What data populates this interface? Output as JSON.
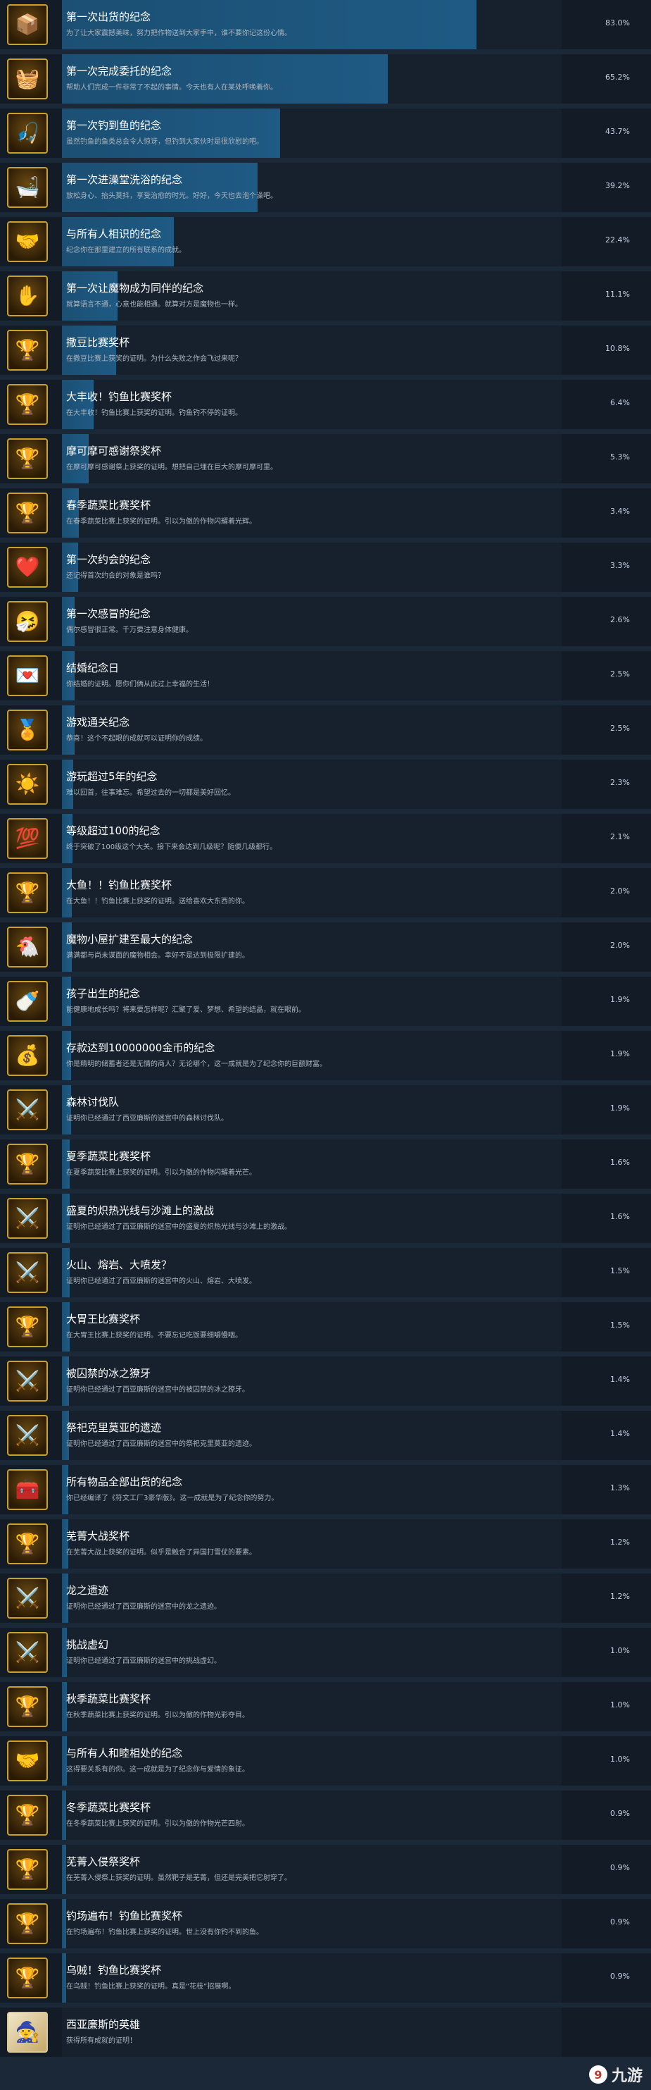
{
  "achievements": [
    {
      "icon": "📦",
      "title": "第一次出货的纪念",
      "desc": "为了让大家震撼美味，努力把作物送到大家手中，谁不要你记这份心情。",
      "pct": "83.0%",
      "value": 83.0
    },
    {
      "icon": "🧺",
      "title": "第一次完成委托的纪念",
      "desc": "帮助人们完成一件非常了不起的事情。今天也有人在某处呼唤着你。",
      "pct": "65.2%",
      "value": 65.2
    },
    {
      "icon": "🎣",
      "title": "第一次钓到鱼的纪念",
      "desc": "虽然钓鱼的鱼类总会令人惊讶，但钓到大家伙时是很欣慰的吧。",
      "pct": "43.7%",
      "value": 43.7
    },
    {
      "icon": "🛁",
      "title": "第一次进澡堂洗浴的纪念",
      "desc": "放松身心、抬头莫抖，享受治愈的时光。好好，今天也去泡个澡吧。",
      "pct": "39.2%",
      "value": 39.2
    },
    {
      "icon": "🤝",
      "title": "与所有人相识的纪念",
      "desc": "纪念你在那里建立的所有联系的成就。",
      "pct": "22.4%",
      "value": 22.4
    },
    {
      "icon": "✋",
      "title": "第一次让魔物成为同伴的纪念",
      "desc": "就算语言不通，心意也能相通。就算对方是魔物也一样。",
      "pct": "11.1%",
      "value": 11.1
    },
    {
      "icon": "🏆",
      "title": "撒豆比赛奖杯",
      "desc": "在撒豆比赛上获奖的证明。为什么失败之作会飞过来呢？",
      "pct": "10.8%",
      "value": 10.8
    },
    {
      "icon": "🏆",
      "title": "大丰收！钓鱼比赛奖杯",
      "desc": "在大丰收！钓鱼比赛上获奖的证明。钓鱼钓不停的证明。",
      "pct": "6.4%",
      "value": 6.4
    },
    {
      "icon": "🏆",
      "title": "摩可摩可感谢祭奖杯",
      "desc": "在摩可摩可感谢祭上获奖的证明。想把自己埋在巨大的摩可摩可里。",
      "pct": "5.3%",
      "value": 5.3
    },
    {
      "icon": "🏆",
      "title": "春季蔬菜比赛奖杯",
      "desc": "在春季蔬菜比赛上获奖的证明。引以为傲的作物闪耀着光辉。",
      "pct": "3.4%",
      "value": 3.4
    },
    {
      "icon": "❤️",
      "title": "第一次约会的纪念",
      "desc": "还记得首次约会的对象是谁吗？",
      "pct": "3.3%",
      "value": 3.3
    },
    {
      "icon": "🤧",
      "title": "第一次感冒的纪念",
      "desc": "偶尔感冒很正常。千万要注意身体健康。",
      "pct": "2.6%",
      "value": 2.6
    },
    {
      "icon": "💌",
      "title": "结婚纪念日",
      "desc": "你结婚的证明。愿你们俩从此过上幸福的生活！",
      "pct": "2.5%",
      "value": 2.5
    },
    {
      "icon": "🏅",
      "title": "游戏通关纪念",
      "desc": "恭喜！这个不起眼的成就可以证明你的成绩。",
      "pct": "2.5%",
      "value": 2.5
    },
    {
      "icon": "☀️",
      "title": "游玩超过5年的纪念",
      "desc": "难以回首，往事难忘。希望过去的一切都是美好回忆。",
      "pct": "2.3%",
      "value": 2.3
    },
    {
      "icon": "💯",
      "title": "等级超过100的纪念",
      "desc": "终于突破了100级这个大关。接下来会达到几级呢？随便几级都行。",
      "pct": "2.1%",
      "value": 2.1
    },
    {
      "icon": "🏆",
      "title": "大鱼！！钓鱼比赛奖杯",
      "desc": "在大鱼！！钓鱼比赛上获奖的证明。送给喜欢大东西的你。",
      "pct": "2.0%",
      "value": 2.0
    },
    {
      "icon": "🐔",
      "title": "魔物小屋扩建至最大的纪念",
      "desc": "满满都与尚未谋面的魔物相会。幸好不是达到极限扩建的。",
      "pct": "2.0%",
      "value": 2.0
    },
    {
      "icon": "🍼",
      "title": "孩子出生的纪念",
      "desc": "能健康地成长吗？将来要怎样呢？汇聚了爱、梦想、希望的结晶，就在眼前。",
      "pct": "1.9%",
      "value": 1.9
    },
    {
      "icon": "💰",
      "title": "存款达到10000000金币的纪念",
      "desc": "你是精明的储蓄者还是无情的商人？无论哪个，这一成就是为了纪念你的巨额财富。",
      "pct": "1.9%",
      "value": 1.9
    },
    {
      "icon": "⚔️",
      "title": "森林讨伐队",
      "desc": "证明你已经通过了西亚廉斯的迷宫中的森林讨伐队。",
      "pct": "1.9%",
      "value": 1.9
    },
    {
      "icon": "🏆",
      "title": "夏季蔬菜比赛奖杯",
      "desc": "在夏季蔬菜比赛上获奖的证明。引以为傲的作物闪耀着光芒。",
      "pct": "1.6%",
      "value": 1.6
    },
    {
      "icon": "⚔️",
      "title": "盛夏的炽热光线与沙滩上的激战",
      "desc": "证明你已经通过了西亚廉斯的迷宫中的盛夏的炽热光线与沙滩上的激战。",
      "pct": "1.6%",
      "value": 1.6
    },
    {
      "icon": "⚔️",
      "title": "火山、熔岩、大喷发？",
      "desc": "证明你已经通过了西亚廉斯的迷宫中的火山、熔岩、大喷发。",
      "pct": "1.5%",
      "value": 1.5
    },
    {
      "icon": "🏆",
      "title": "大胃王比赛奖杯",
      "desc": "在大胃王比赛上获奖的证明。不要忘记吃饭要细嚼慢咽。",
      "pct": "1.5%",
      "value": 1.5
    },
    {
      "icon": "⚔️",
      "title": "被囚禁的冰之獠牙",
      "desc": "证明你已经通过了西亚廉斯的迷宫中的被囚禁的冰之獠牙。",
      "pct": "1.4%",
      "value": 1.4
    },
    {
      "icon": "⚔️",
      "title": "祭祀克里莫亚的遗迹",
      "desc": "证明你已经通过了西亚廉斯的迷宫中的祭祀克里莫亚的遗迹。",
      "pct": "1.4%",
      "value": 1.4
    },
    {
      "icon": "🧰",
      "title": "所有物品全部出货的纪念",
      "desc": "你已经编译了《符文工厂3豪华版》。这一成就是为了纪念你的努力。",
      "pct": "1.3%",
      "value": 1.3
    },
    {
      "icon": "🏆",
      "title": "芜菁大战奖杯",
      "desc": "在芜菁大战上获奖的证明。似乎是触合了异国打雪仗的要素。",
      "pct": "1.2%",
      "value": 1.2
    },
    {
      "icon": "⚔️",
      "title": "龙之遗迹",
      "desc": "证明你已经通过了西亚廉斯的迷宫中的龙之遗迹。",
      "pct": "1.2%",
      "value": 1.2
    },
    {
      "icon": "⚔️",
      "title": "挑战虚幻",
      "desc": "证明你已经通过了西亚廉斯的迷宫中的挑战虚幻。",
      "pct": "1.0%",
      "value": 1.0
    },
    {
      "icon": "🏆",
      "title": "秋季蔬菜比赛奖杯",
      "desc": "在秋季蔬菜比赛上获奖的证明。引以为傲的作物光彩夺目。",
      "pct": "1.0%",
      "value": 1.0
    },
    {
      "icon": "🤝",
      "title": "与所有人和睦相处的纪念",
      "desc": "这得要关系有的你。这一成就是为了纪念你与爱情的象征。",
      "pct": "1.0%",
      "value": 1.0
    },
    {
      "icon": "🏆",
      "title": "冬季蔬菜比赛奖杯",
      "desc": "在冬季蔬菜比赛上获奖的证明。引以为傲的作物光芒四射。",
      "pct": "0.9%",
      "value": 0.9
    },
    {
      "icon": "🏆",
      "title": "芜菁入侵祭奖杯",
      "desc": "在芜菁入侵祭上获奖的证明。虽然靶子是芜菁，但还是完美把它射穿了。",
      "pct": "0.9%",
      "value": 0.9
    },
    {
      "icon": "🏆",
      "title": "钓场遍布！钓鱼比赛奖杯",
      "desc": "在钓场遍布！钓鱼比赛上获奖的证明。世上没有你钓不到的鱼。",
      "pct": "0.9%",
      "value": 0.9
    },
    {
      "icon": "🏆",
      "title": "乌贼！钓鱼比赛奖杯",
      "desc": "在乌贼！钓鱼比赛上获奖的证明。真是“花枝”招展啊。",
      "pct": "0.9%",
      "value": 0.9
    },
    {
      "icon": "🧙",
      "title": "西亚廉斯的英雄",
      "desc": "获得所有成就的证明！",
      "pct": "",
      "value": 0
    }
  ],
  "watermark": {
    "text": "九游",
    "badge": "9"
  }
}
